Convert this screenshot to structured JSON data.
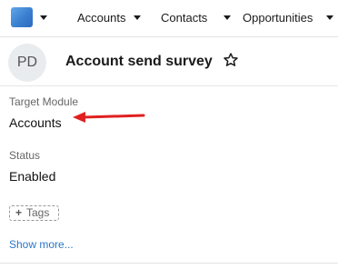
{
  "nav": {
    "logo_icon": "app-logo",
    "items": [
      {
        "label": "Accounts"
      },
      {
        "label": "Contacts"
      },
      {
        "label": "Opportunities"
      }
    ]
  },
  "header": {
    "avatar_initials": "PD",
    "title": "Account send survey",
    "star_icon": "star-outline-icon"
  },
  "fields": {
    "target_module": {
      "label": "Target Module",
      "value": "Accounts"
    },
    "status": {
      "label": "Status",
      "value": "Enabled"
    }
  },
  "tags": {
    "label": "Tags",
    "icon": "plus-icon"
  },
  "show_more": "Show more...",
  "annotation": {
    "color": "#e02020"
  },
  "colors": {
    "link": "#2a78c7",
    "accent": "#3a7fd0"
  }
}
